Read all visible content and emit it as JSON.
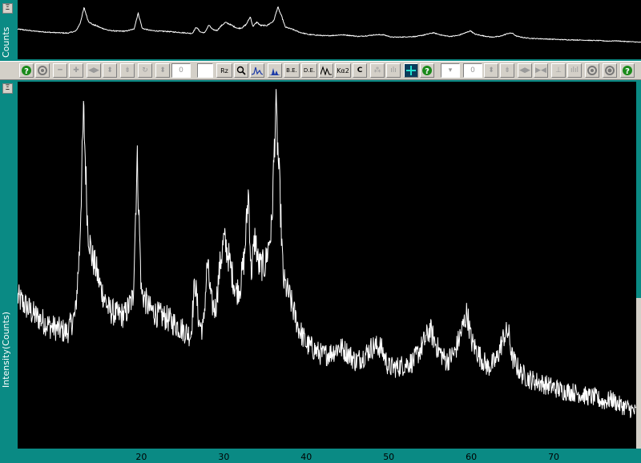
{
  "overview": {
    "y_label": "Counts",
    "collapse_label": "Ξ"
  },
  "main": {
    "y_label": "Intensity(Counts)",
    "collapse_label": "Ξ"
  },
  "toolbar": {
    "step_value_1": "0",
    "step_value_2": "0",
    "zoom_label": "Rz",
    "background_label": "B.E.",
    "derivative_label": "D.E.",
    "ka2_label": "Kα2",
    "calib_label": "C"
  },
  "chart_data": {
    "type": "line",
    "xlabel": "",
    "ylabel": "Intensity(Counts)",
    "xlim": [
      5,
      80
    ],
    "x_ticks": [
      "20",
      "30",
      "40",
      "50",
      "60",
      "70"
    ],
    "grid": false,
    "series": [
      {
        "color": "#ffffff",
        "x": [
          5,
          7,
          9,
          11,
          12,
          12.5,
          13,
          13.5,
          14,
          14.5,
          15,
          16,
          17,
          18,
          19,
          19.5,
          20,
          21,
          22,
          23,
          24,
          25,
          26,
          26.5,
          27,
          27.5,
          28,
          28.5,
          29,
          29.5,
          30,
          30.5,
          31,
          31.5,
          32,
          32.5,
          33,
          33.3,
          33.8,
          34.2,
          35,
          35.8,
          36.3,
          36.8,
          37.2,
          38,
          39,
          40,
          41,
          42,
          43,
          44,
          45,
          46,
          47,
          48,
          49,
          50,
          51,
          52,
          53,
          54,
          55,
          56,
          57,
          58,
          59,
          59.5,
          60,
          61,
          62,
          63,
          64,
          64.5,
          65,
          66,
          67,
          68,
          69,
          70,
          71,
          72,
          73,
          74,
          75,
          76,
          77,
          78,
          79,
          80
        ],
        "y": [
          260,
          230,
          210,
          200,
          230,
          340,
          580,
          380,
          330,
          310,
          280,
          240,
          230,
          230,
          260,
          500,
          270,
          240,
          230,
          225,
          215,
          205,
          195,
          290,
          215,
          205,
          320,
          250,
          240,
          310,
          360,
          335,
          300,
          270,
          280,
          330,
          445,
          300,
          365,
          315,
          315,
          380,
          590,
          440,
          290,
          260,
          210,
          180,
          170,
          160,
          165,
          175,
          165,
          150,
          160,
          175,
          175,
          140,
          140,
          145,
          150,
          175,
          205,
          170,
          150,
          165,
          210,
          235,
          185,
          160,
          140,
          150,
          195,
          200,
          155,
          130,
          120,
          115,
          110,
          105,
          100,
          98,
          95,
          90,
          88,
          80,
          85,
          75,
          70,
          62
        ]
      }
    ]
  }
}
